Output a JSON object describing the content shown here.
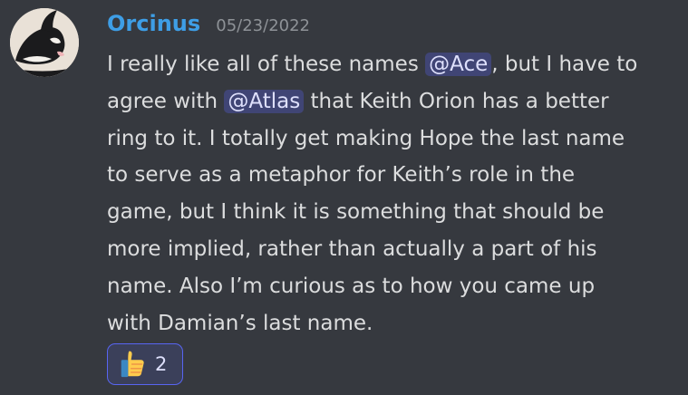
{
  "message": {
    "author": "Orcinus",
    "timestamp": "05/23/2022",
    "author_color": "#3e9ee6",
    "lines": [
      {
        "pre": "I really like all of these names ",
        "mention": "@Ace",
        "post": ", but I have to"
      },
      {
        "pre": "agree with ",
        "mention": "@Atlas",
        "post": " that Keith Orion has a better"
      },
      {
        "text": "ring to it. I totally get making Hope the last name"
      },
      {
        "text": "to serve as a metaphor for Keith’s role in the"
      },
      {
        "text": "game, but I think it is something that should be"
      },
      {
        "text": "more implied, rather than actually a part of his"
      },
      {
        "text": "name. Also I’m curious as to how you came up"
      },
      {
        "text": "with Damian’s last name."
      }
    ]
  },
  "reaction": {
    "emoji": "thumbs-up-icon",
    "count": "2",
    "border_color": "#5865f2"
  },
  "avatar": {
    "icon": "orca-avatar-icon"
  },
  "theme": {
    "background": "#36393f",
    "text": "#dcddde",
    "timestamp": "#8e9297",
    "mention_bg": "#414675"
  }
}
